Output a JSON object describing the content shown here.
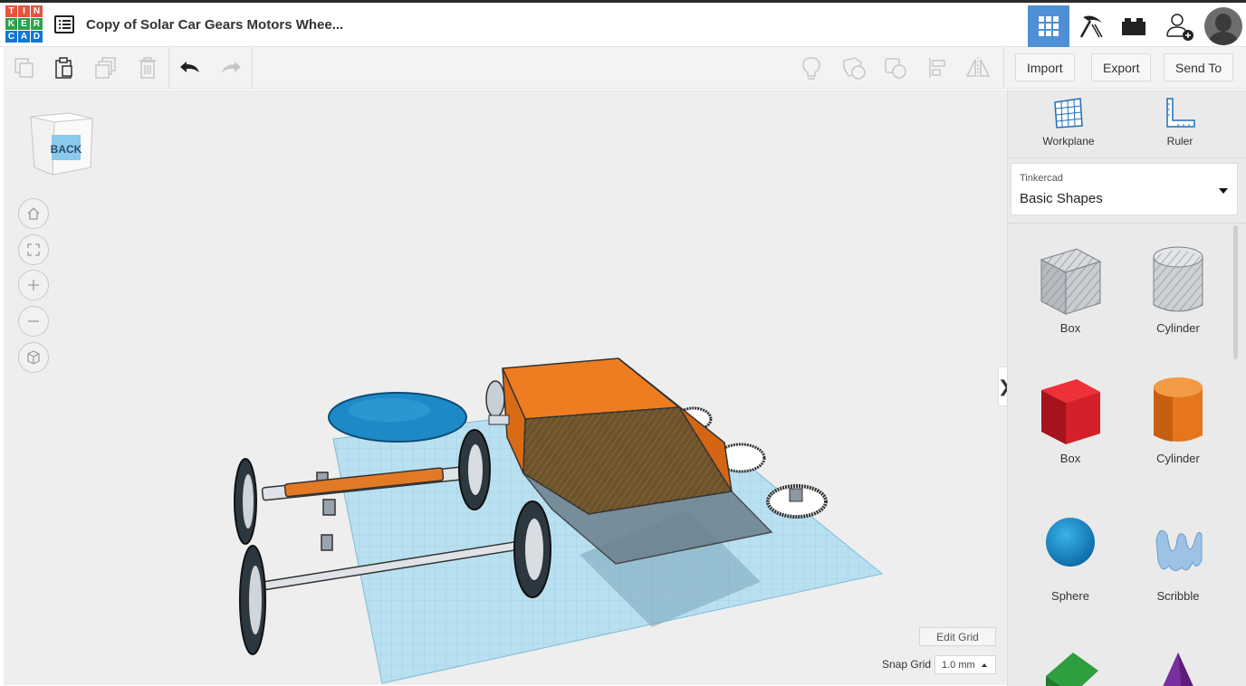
{
  "header": {
    "logo_letters": [
      "T",
      "I",
      "N",
      "K",
      "E",
      "R",
      "C",
      "A",
      "D"
    ],
    "logo_colors": [
      "#e6543b",
      "#e6543b",
      "#e6543b",
      "#2fa04d",
      "#2fa04d",
      "#2fa04d",
      "#1477d1",
      "#1477d1",
      "#1477d1"
    ],
    "design_title": "Copy of Solar Car Gears Motors Whee...",
    "icons": [
      "grid-view-icon",
      "pickaxe-icon",
      "bricks-icon",
      "add-user-icon"
    ],
    "accent_color": "#4f8fd5"
  },
  "toolbar": {
    "left_icons": [
      "copy-icon",
      "paste-icon",
      "duplicate-icon",
      "delete-icon",
      "undo-icon",
      "redo-icon"
    ],
    "right_icons": [
      "notes-icon",
      "group-icon",
      "ungroup-icon",
      "align-icon",
      "mirror-icon"
    ],
    "import_label": "Import",
    "export_label": "Export",
    "send_to_label": "Send To"
  },
  "viewport": {
    "view_cube_face": "BACK",
    "nav_icons": [
      "home-view-icon",
      "fit-view-icon",
      "zoom-in-icon",
      "zoom-out-icon",
      "perspective-icon"
    ],
    "edit_grid_label": "Edit Grid",
    "snap_grid_label": "Snap Grid",
    "snap_grid_value": "1.0 mm",
    "collapse_glyph": "❯"
  },
  "panel": {
    "workplane_label": "Workplane",
    "ruler_label": "Ruler",
    "library_source": "Tinkercad",
    "library_name": "Basic Shapes",
    "shapes": [
      {
        "label": "Box",
        "kind": "hole-box"
      },
      {
        "label": "Cylinder",
        "kind": "hole-cylinder"
      },
      {
        "label": "Box",
        "kind": "box",
        "color": "#d9232d"
      },
      {
        "label": "Cylinder",
        "kind": "cylinder",
        "color": "#ec7f22"
      },
      {
        "label": "Sphere",
        "kind": "sphere",
        "color": "#1d8ac7"
      },
      {
        "label": "Scribble",
        "kind": "scribble",
        "color": "#8fb9e0"
      }
    ]
  }
}
